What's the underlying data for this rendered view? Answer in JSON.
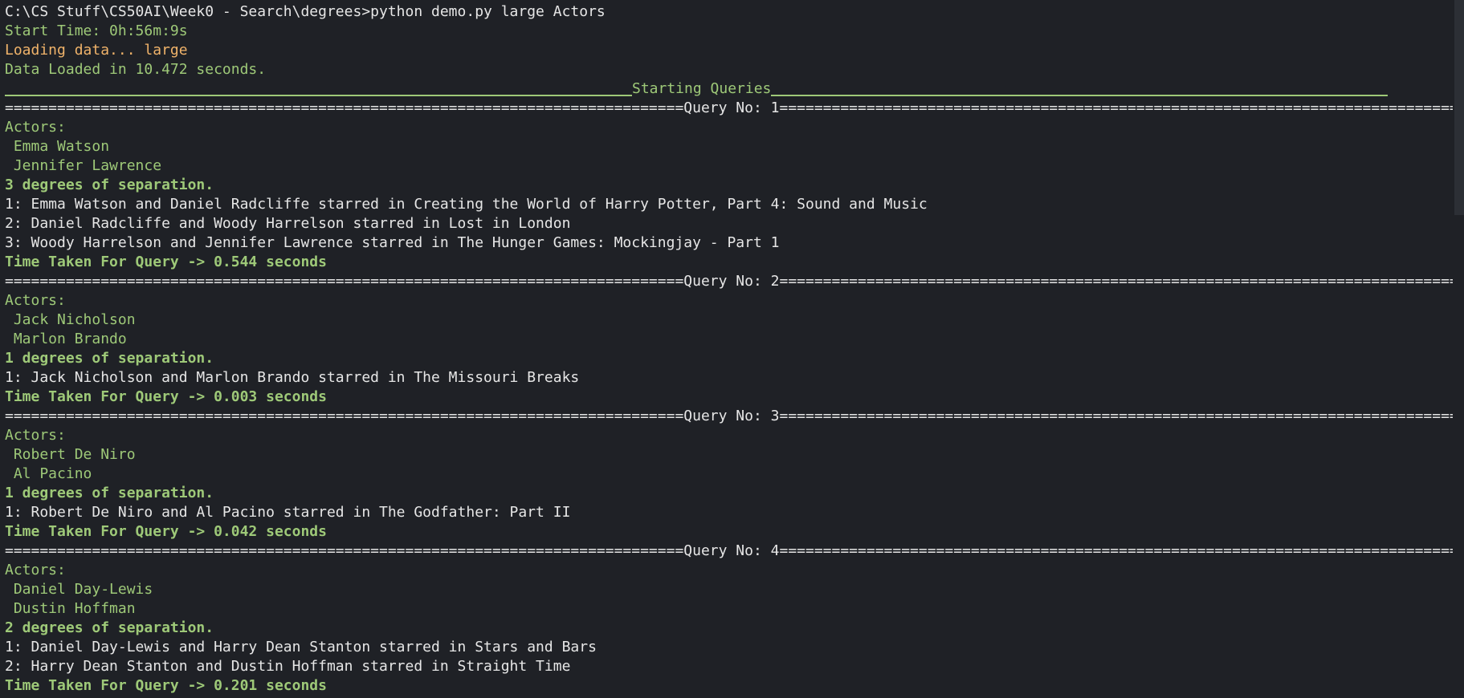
{
  "terminal": {
    "command_line": "C:\\CS Stuff\\CS50AI\\Week0 - Search\\degrees>python demo.py large Actors",
    "start_time": "Start Time: 0h:56m:9s",
    "loading": "Loading data... large",
    "loaded": "Data Loaded in 10.472 seconds.",
    "starting_queries": "Starting Queries",
    "queries": [
      {
        "header": "==============================================================================Query No: 1==================================================================================",
        "actors_label": "Actors:",
        "actor1": " Emma Watson",
        "actor2": " Jennifer Lawrence",
        "degrees": "3 degrees of separation.",
        "steps": [
          "1: Emma Watson and Daniel Radcliffe starred in Creating the World of Harry Potter, Part 4: Sound and Music",
          "2: Daniel Radcliffe and Woody Harrelson starred in Lost in London",
          "3: Woody Harrelson and Jennifer Lawrence starred in The Hunger Games: Mockingjay - Part 1"
        ],
        "time": "Time Taken For Query -> 0.544 seconds"
      },
      {
        "header": "==============================================================================Query No: 2==================================================================================",
        "actors_label": "Actors:",
        "actor1": " Jack Nicholson",
        "actor2": " Marlon Brando",
        "degrees": "1 degrees of separation.",
        "steps": [
          "1: Jack Nicholson and Marlon Brando starred in The Missouri Breaks"
        ],
        "time": "Time Taken For Query -> 0.003 seconds"
      },
      {
        "header": "==============================================================================Query No: 3==================================================================================",
        "actors_label": "Actors:",
        "actor1": " Robert De Niro",
        "actor2": " Al Pacino",
        "degrees": "1 degrees of separation.",
        "steps": [
          "1: Robert De Niro and Al Pacino starred in The Godfather: Part II"
        ],
        "time": "Time Taken For Query -> 0.042 seconds"
      },
      {
        "header": "==============================================================================Query No: 4==================================================================================",
        "actors_label": "Actors:",
        "actor1": " Daniel Day-Lewis",
        "actor2": " Dustin Hoffman",
        "degrees": "2 degrees of separation.",
        "steps": [
          "1: Daniel Day-Lewis and Harry Dean Stanton starred in Stars and Bars",
          "2: Harry Dean Stanton and Dustin Hoffman starred in Straight Time"
        ],
        "time": "Time Taken For Query -> 0.201 seconds"
      }
    ]
  },
  "colors": {
    "background": "#1f2126",
    "text": "#e6e6e6",
    "green": "#9ec978",
    "orange": "#f0b36a"
  }
}
